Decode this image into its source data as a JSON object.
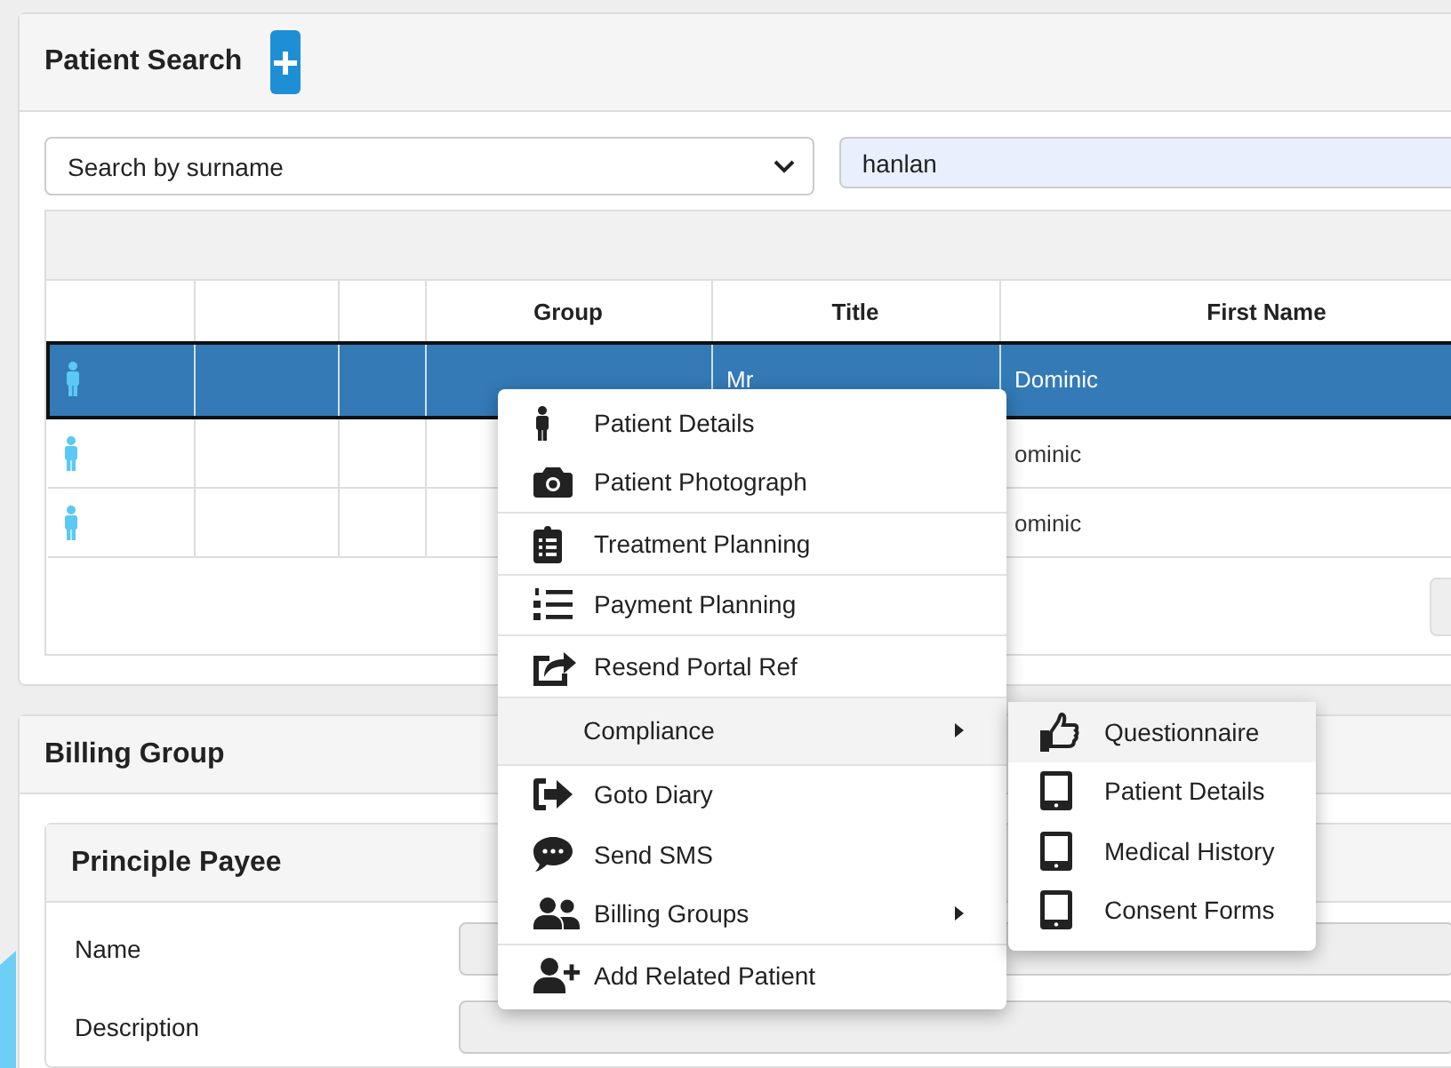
{
  "patient_search": {
    "title": "Patient Search",
    "search_by": "Search by surname",
    "query": "hanlan",
    "table": {
      "columns": [
        "Group",
        "Title",
        "First Name"
      ],
      "rows": [
        {
          "selected": true,
          "title": "Mr",
          "first_name": "Dominic"
        },
        {
          "selected": false,
          "first_name": "ominic"
        },
        {
          "selected": false,
          "first_name": "ominic"
        }
      ]
    }
  },
  "billing_group": {
    "title": "Billing Group",
    "principle_payee": {
      "title": "Principle Payee",
      "fields": [
        {
          "label": "Name"
        },
        {
          "label": "Description"
        }
      ]
    }
  },
  "context_menu": {
    "groups": [
      [
        {
          "label": "Patient Details",
          "highlighted": false,
          "has_submenu": false
        },
        {
          "label": "Patient Photograph",
          "highlighted": false,
          "has_submenu": false
        }
      ],
      [
        {
          "label": "Treatment Planning",
          "highlighted": false,
          "has_submenu": false
        }
      ],
      [
        {
          "label": "Payment Planning",
          "highlighted": false,
          "has_submenu": false
        }
      ],
      [
        {
          "label": "Resend Portal Ref",
          "highlighted": false,
          "has_submenu": false
        }
      ],
      [
        {
          "label": "Compliance",
          "highlighted": true,
          "has_submenu": true
        }
      ],
      [
        {
          "label": "Goto Diary",
          "highlighted": false,
          "has_submenu": false
        },
        {
          "label": "Send SMS",
          "highlighted": false,
          "has_submenu": false
        },
        {
          "label": "Billing Groups",
          "highlighted": false,
          "has_submenu": true
        }
      ],
      [
        {
          "label": "Add Related Patient",
          "highlighted": false,
          "has_submenu": false
        }
      ]
    ],
    "submenu": [
      {
        "label": "Questionnaire",
        "highlighted": true
      },
      {
        "label": "Patient Details",
        "highlighted": false
      },
      {
        "label": "Medical History",
        "highlighted": false
      },
      {
        "label": "Consent Forms",
        "highlighted": false
      }
    ]
  }
}
